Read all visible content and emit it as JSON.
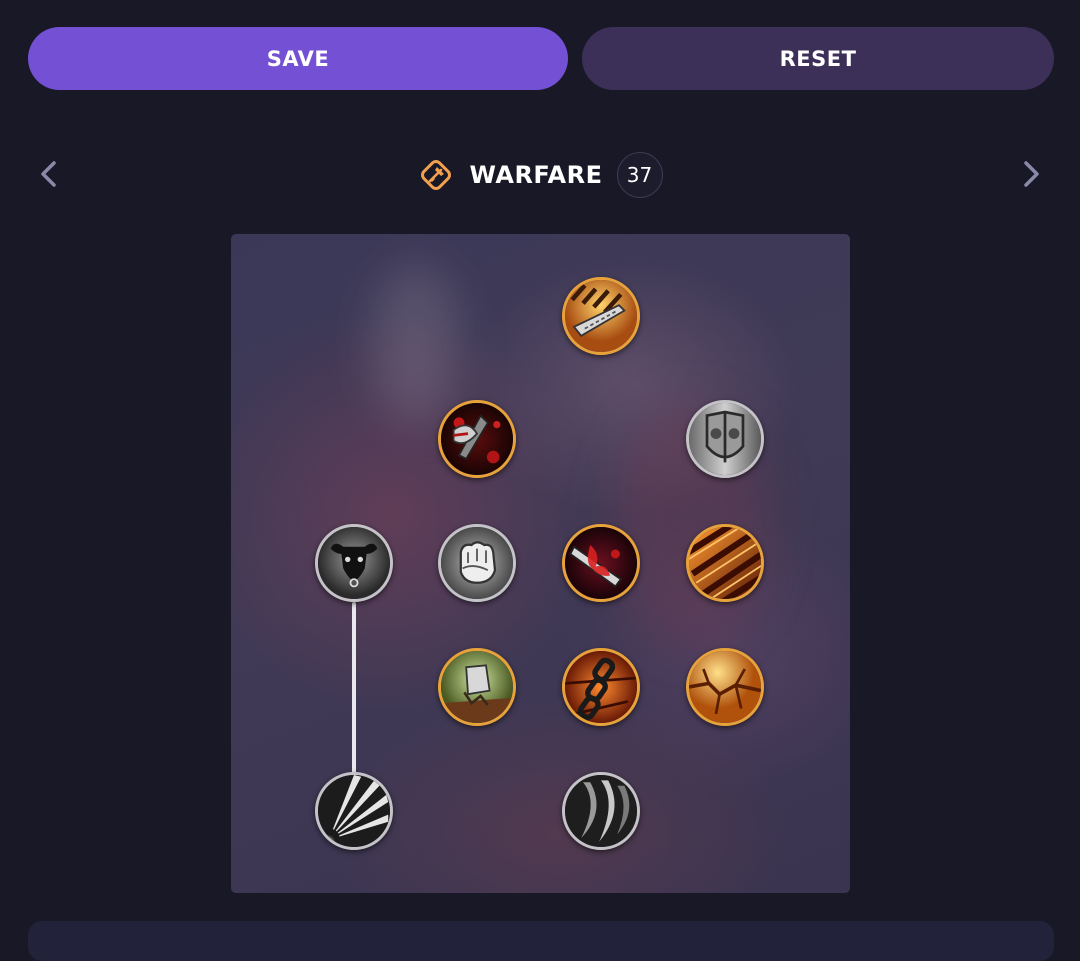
{
  "toolbar": {
    "save_label": "SAVE",
    "reset_label": "RESET"
  },
  "tree": {
    "title": "WARFARE",
    "points": "37",
    "icon": "warfare-axe-icon",
    "prev_icon": "chevron-left-icon",
    "next_icon": "chevron-right-icon"
  },
  "colors": {
    "background": "#181827",
    "save": "#7451d4",
    "reset": "#3d3058",
    "accent_orange": "#f2a04e",
    "gold_ring": "#e8a23a",
    "silver_ring": "#c4c4c8"
  },
  "talents": [
    {
      "name": "talent-flaming-blade",
      "icon": "flaming-blade-icon",
      "row": 1,
      "col": 3,
      "ring": "gold"
    },
    {
      "name": "talent-bloody-axe",
      "icon": "bloody-axe-icon",
      "row": 2,
      "col": 2,
      "ring": "gold"
    },
    {
      "name": "talent-iron-shield",
      "icon": "iron-shield-icon",
      "row": 2,
      "col": 4,
      "ring": "silver"
    },
    {
      "name": "talent-bull-rush",
      "icon": "bull-head-icon",
      "row": 3,
      "col": 1,
      "ring": "silver"
    },
    {
      "name": "talent-iron-fist",
      "icon": "fist-icon",
      "row": 3,
      "col": 2,
      "ring": "silver"
    },
    {
      "name": "talent-rending-strike",
      "icon": "rending-blade-icon",
      "row": 3,
      "col": 3,
      "ring": "gold"
    },
    {
      "name": "talent-blazing-slashes",
      "icon": "fire-slashes-icon",
      "row": 3,
      "col": 4,
      "ring": "gold"
    },
    {
      "name": "talent-ground-slam",
      "icon": "stone-fist-icon",
      "row": 4,
      "col": 2,
      "ring": "gold"
    },
    {
      "name": "talent-molten-chain",
      "icon": "chain-icon",
      "row": 4,
      "col": 3,
      "ring": "gold"
    },
    {
      "name": "talent-earth-crack",
      "icon": "cracked-earth-icon",
      "row": 4,
      "col": 4,
      "ring": "gold"
    },
    {
      "name": "talent-piercing-rays",
      "icon": "steel-rays-icon",
      "row": 5,
      "col": 1,
      "ring": "silver"
    },
    {
      "name": "talent-shadow-claws",
      "icon": "steel-claws-icon",
      "row": 5,
      "col": 3,
      "ring": "silver"
    }
  ],
  "links": [
    {
      "from": "talent-bull-rush",
      "to": "talent-piercing-rays"
    }
  ]
}
